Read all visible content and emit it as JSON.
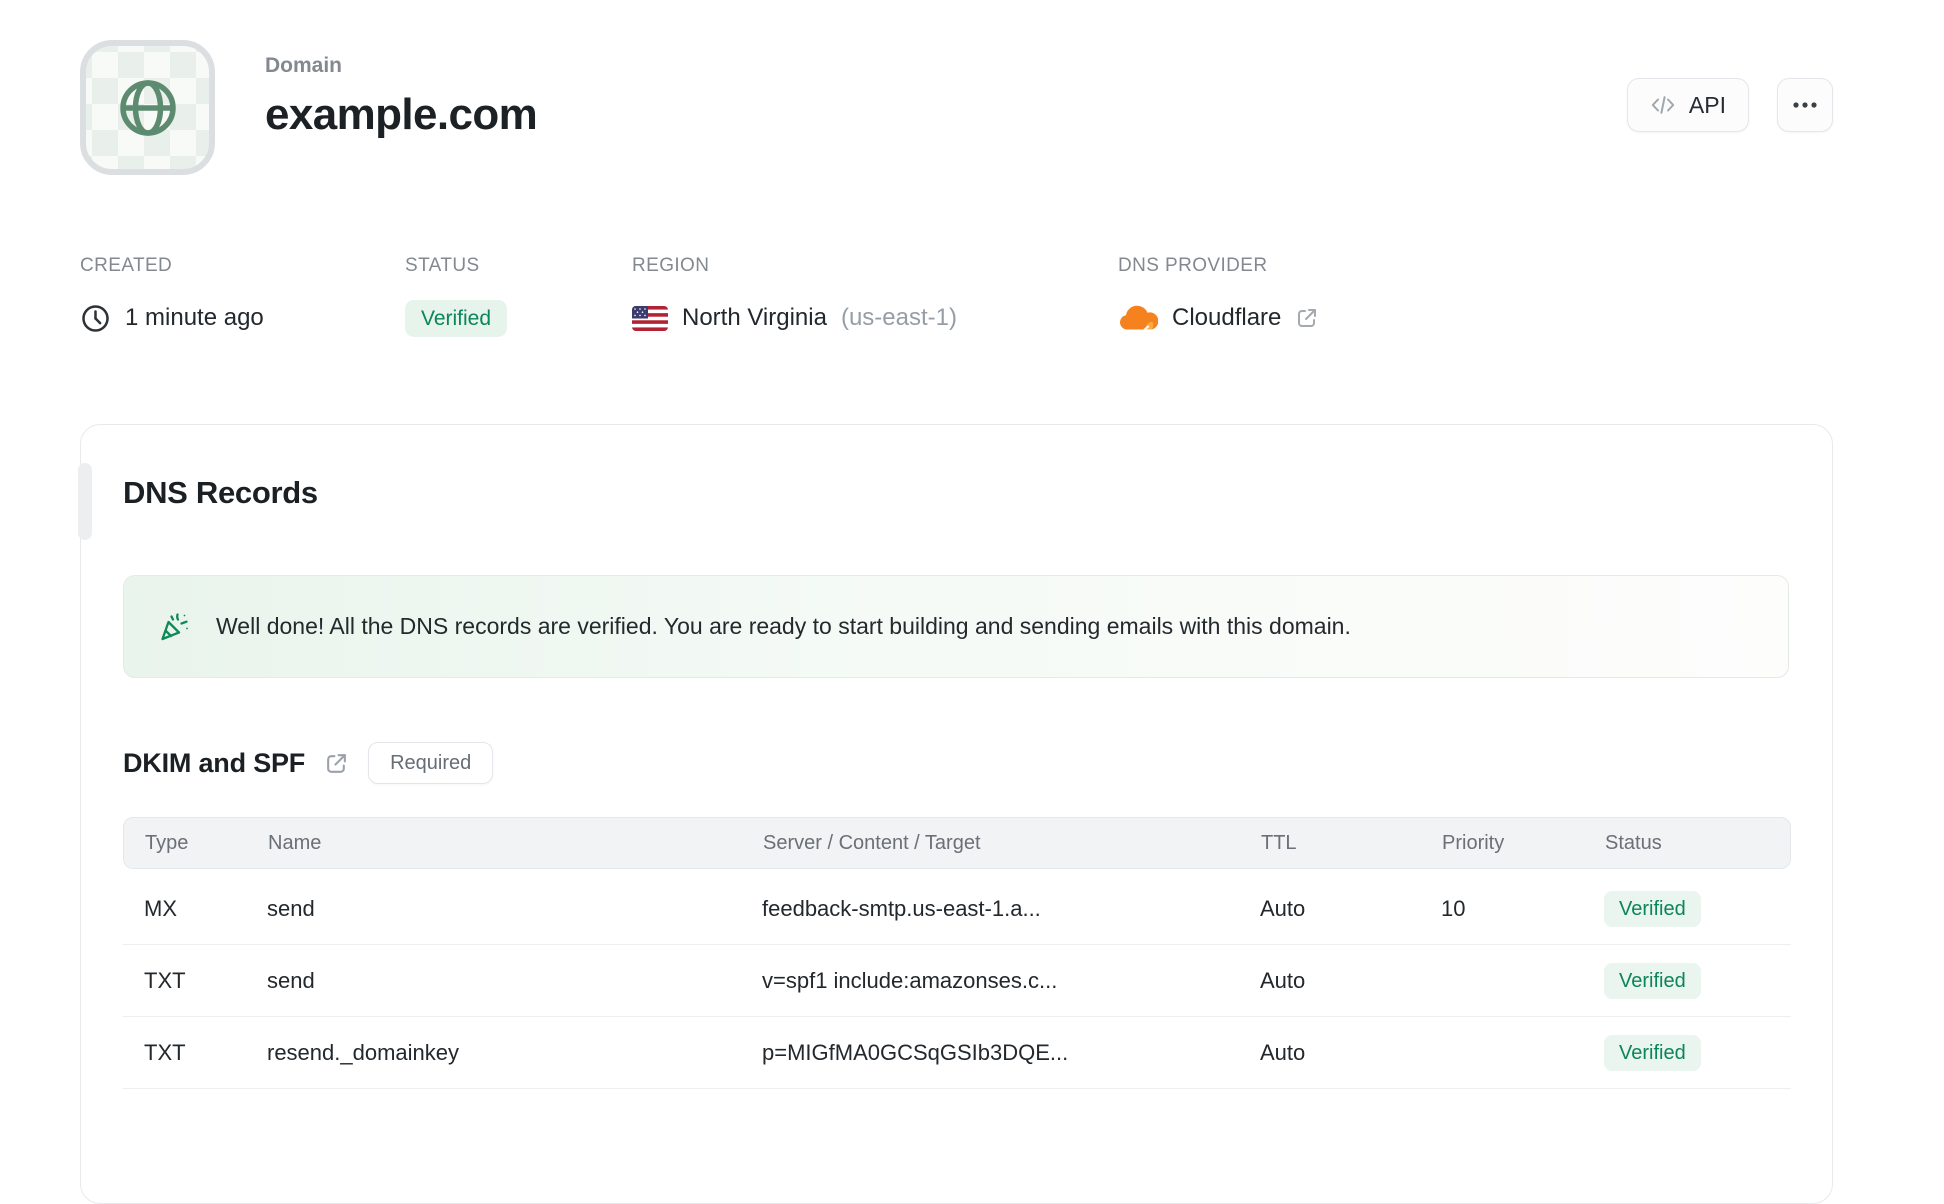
{
  "header": {
    "kicker": "Domain",
    "title": "example.com",
    "api_label": "API",
    "icons": {
      "tile": "globe-icon",
      "api": "code-icon",
      "more": "ellipsis-icon"
    }
  },
  "meta": {
    "created": {
      "label": "CREATED",
      "value": "1 minute ago",
      "icon": "clock-icon"
    },
    "status": {
      "label": "STATUS",
      "value": "Verified"
    },
    "region": {
      "label": "REGION",
      "value": "North Virginia",
      "code": "(us-east-1)",
      "icon": "us-flag-icon"
    },
    "provider": {
      "label": "DNS PROVIDER",
      "value": "Cloudflare",
      "icon": "cloudflare-icon",
      "link_icon": "external-link-icon"
    }
  },
  "card": {
    "title": "DNS Records",
    "banner": {
      "icon": "party-popper-icon",
      "text": "Well done! All the DNS records are verified. You are ready to start building and sending emails with this domain."
    },
    "dkim_section": {
      "title": "DKIM and SPF",
      "link_icon": "external-link-icon",
      "badge": "Required"
    },
    "table": {
      "columns": [
        "Type",
        "Name",
        "Server / Content / Target",
        "TTL",
        "Priority",
        "Status"
      ],
      "rows": [
        {
          "type": "MX",
          "name": "send",
          "content": "feedback-smtp.us-east-1.a...",
          "ttl": "Auto",
          "priority": "10",
          "status": "Verified"
        },
        {
          "type": "TXT",
          "name": "send",
          "content": "v=spf1 include:amazonses.c...",
          "ttl": "Auto",
          "priority": "",
          "status": "Verified"
        },
        {
          "type": "TXT",
          "name": "resend._domainkey",
          "content": "p=MIGfMA0GCSqGSIb3DQE...",
          "ttl": "Auto",
          "priority": "",
          "status": "Verified"
        }
      ]
    }
  },
  "colors": {
    "accent_green": "#0c855a",
    "badge_bg": "#e9f5ee",
    "banner_gradient_start": "#e9f4ec",
    "cloudflare_orange": "#f6821f",
    "cloudflare_light": "#fbad41",
    "globe_green": "#5d8b70",
    "border_gray": "#e7eaec",
    "label_gray": "#83898f"
  }
}
